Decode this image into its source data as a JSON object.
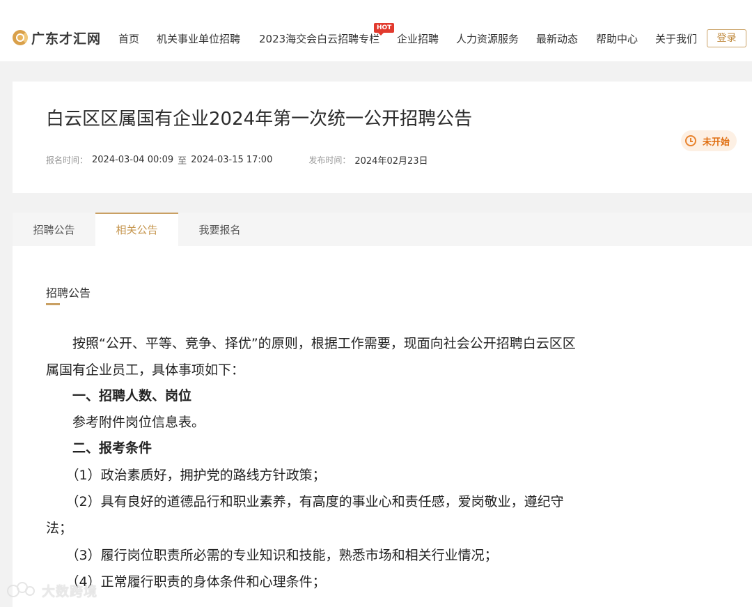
{
  "site": {
    "logo_text": "广东才汇网"
  },
  "nav": {
    "items": [
      {
        "label": "首页"
      },
      {
        "label": "机关事业单位招聘"
      },
      {
        "label": "2023海交会白云招聘专栏"
      },
      {
        "label": "企业招聘"
      },
      {
        "label": "人力资源服务"
      },
      {
        "label": "最新动态"
      },
      {
        "label": "帮助中心"
      },
      {
        "label": "关于我们"
      }
    ],
    "hot_badge": "HOT",
    "login_label": "登录"
  },
  "notice": {
    "title": "白云区区属国有企业2024年第一次统一公开招聘公告",
    "signup_label": "报名时间：",
    "signup_start": "2024-03-04 00:09",
    "signup_to": "至",
    "signup_end": "2024-03-15 17:00",
    "publish_label": "发布时间：",
    "publish_date": "2024年02月23日",
    "status": "未开始"
  },
  "tabs": [
    {
      "label": "招聘公告",
      "active": false
    },
    {
      "label": "相关公告",
      "active": true
    },
    {
      "label": "我要报名",
      "active": false
    }
  ],
  "content": {
    "section_label": "招聘公告",
    "lines": [
      "　　按照“公开、平等、竞争、择优”的原则，根据工作需要，现面向社会公开招聘白云区区",
      "属国有企业员工，具体事项如下：",
      "　　一、招聘人数、岗位",
      "　　参考附件岗位信息表。",
      "　　二、报考条件",
      "　　（1）政治素质好，拥护党的路线方针政策；",
      "　　（2）具有良好的道德品行和职业素养，有高度的事业心和责任感，爱岗敬业，遵纪守",
      "法；",
      "　　（3）履行岗位职责所必需的专业知识和技能，熟悉市场和相关行业情况；",
      "　　（4）正常履行职责的身体条件和心理条件；"
    ]
  },
  "watermark": {
    "text": "大数跨境"
  },
  "colors": {
    "accent": "#c9a063",
    "hot": "#e23a2e",
    "status": "#e06f12"
  }
}
